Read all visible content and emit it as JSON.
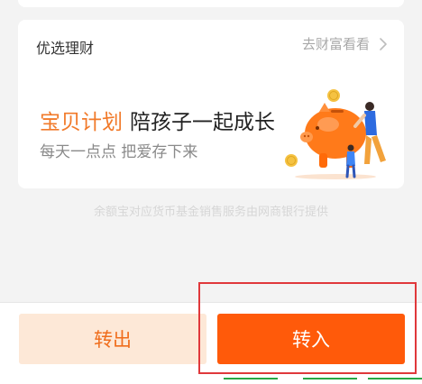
{
  "section": {
    "title": "优选理财",
    "link_label": "去财富看看",
    "link_icon": "chevron-right-icon"
  },
  "promo": {
    "brand": "宝贝计划",
    "tagline": "陪孩子一起成长",
    "subtitle": "每天一点点 把爱存下来",
    "illustration": "piggy-bank-family-icon"
  },
  "disclaimer": "余额宝对应货币基金销售服务由网商银行提供",
  "actions": {
    "transfer_out_label": "转出",
    "transfer_in_label": "转入"
  },
  "colors": {
    "accent": "#ff5a0a",
    "accent_light": "#fde8d7",
    "brand_orange": "#f17a2a",
    "highlight_red": "#e0383b"
  }
}
